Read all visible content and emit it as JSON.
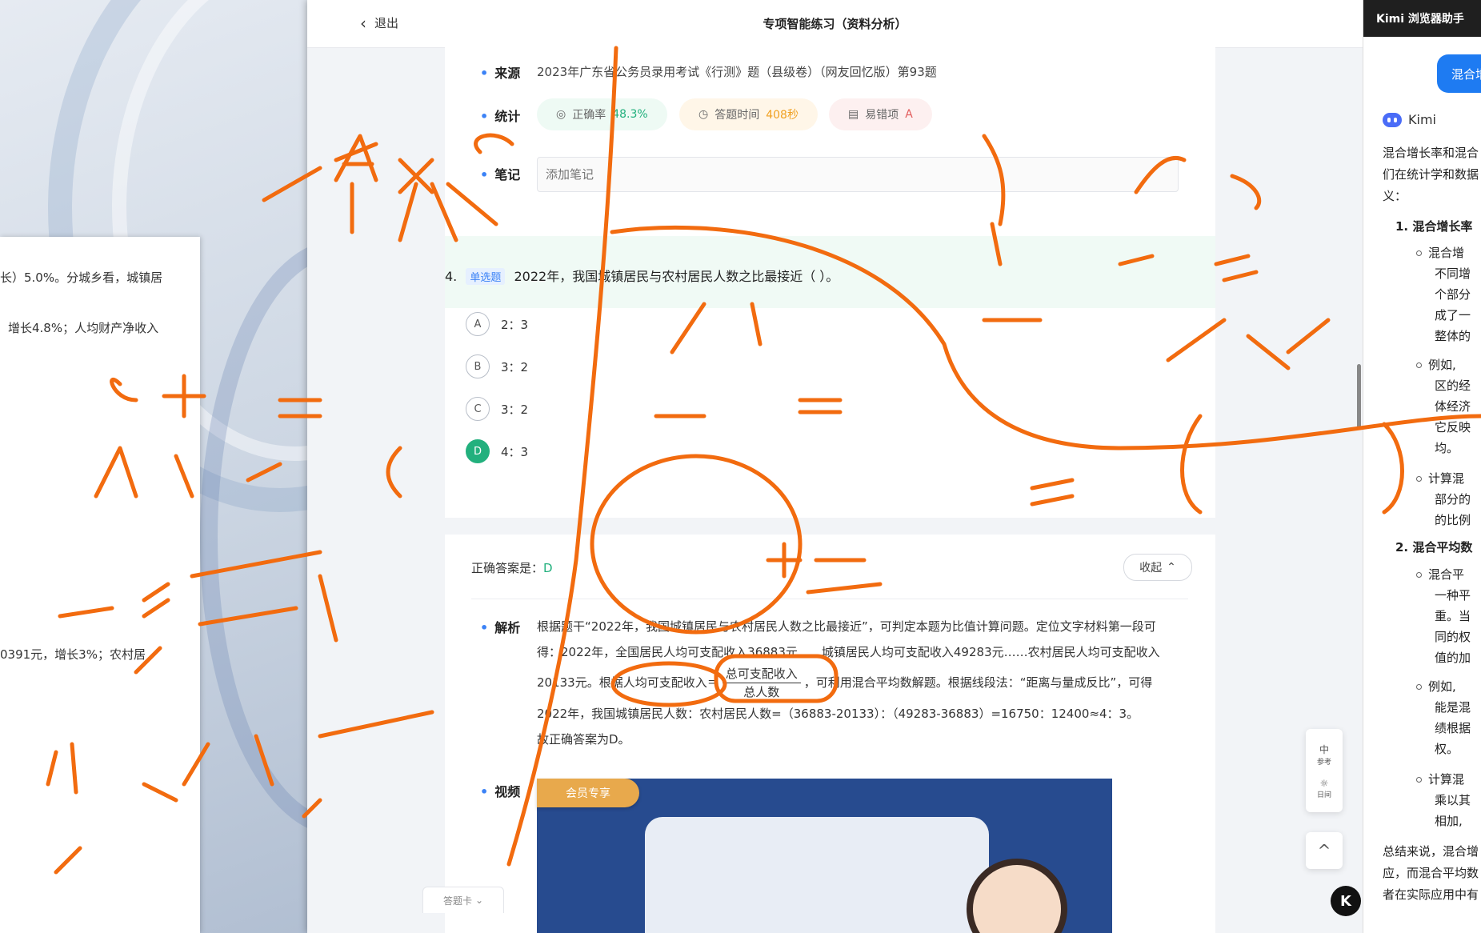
{
  "left_doc": {
    "lines": [
      "长）5.0%。分城乡看，城镇居",
      "增长4.8%；人均财产净收入",
      "0391元，增长3%；农村居"
    ]
  },
  "header": {
    "back_label": "退出",
    "title": "专项智能练习（资料分析）"
  },
  "meta": {
    "source_label": "来源",
    "source_text": "2023年广东省公务员录用考试《行测》题（县级卷）（网友回忆版）第93题",
    "stats_label": "统计",
    "accuracy_label": "正确率",
    "accuracy_value": "48.3%",
    "time_label": "答题时间",
    "time_value": "408秒",
    "wrong_label": "易错项",
    "wrong_value": "A",
    "notes_label": "笔记",
    "notes_placeholder": "添加笔记"
  },
  "question": {
    "number": "4.",
    "tag": "单选题",
    "text": "2022年，我国城镇居民与农村居民人数之比最接近（ ）。",
    "options": [
      {
        "letter": "A",
        "text": "2：3",
        "selected": false
      },
      {
        "letter": "B",
        "text": "3：2",
        "selected": false
      },
      {
        "letter": "C",
        "text": "3：2",
        "selected": false
      },
      {
        "letter": "D",
        "text": "4：3",
        "selected": true
      }
    ]
  },
  "answer": {
    "correct_label": "正确答案是：",
    "correct_value": "D",
    "collapse_label": "收起",
    "analysis_label": "解析",
    "analysis_p1": "根据题干“2022年，我国城镇居民与农村居民人数之比最接近”，可判定本题为比值计算问题。定位文字材料第一段可得：2022年，全国居民人均可支配收入36883元……城镇居民人均可支配收入49283元……农村居民人均可支配收入20133元。根据人均可支配收入＝",
    "frac_num": "总可支配收入",
    "frac_den": "总人数",
    "analysis_p2": "，可利用混合平均数解题。根据线段法：“距离与量成反比”，可得2022年，我国城镇居民人数：农村居民人数=（36883-20133）：（49283-36883）=16750：12400≈4：3。",
    "analysis_p3": "故正确答案为D。",
    "video_label": "视频",
    "vip_label": "会员专享"
  },
  "side_tools": {
    "ref_top": "中",
    "ref_bottom": "参考",
    "day_bottom": "日间",
    "up_icon": "^"
  },
  "answer_sheet_label": "答题卡",
  "kimi": {
    "header": "Kimi 浏览器助手",
    "user_msg": "混合增",
    "bot_name": "Kimi",
    "lines": [
      "混合增长率和混合",
      "们在统计学和数据",
      "义："
    ],
    "h1": "1. 混合增长率",
    "l1": [
      "混合增",
      "不同增",
      "个部分",
      "成了一",
      "整体的"
    ],
    "l2": [
      "例如,",
      "区的经",
      "体经济",
      "它反映",
      "均。"
    ],
    "l3": [
      "计算混",
      "部分的",
      "的比例"
    ],
    "h2": "2. 混合平均数",
    "l4": [
      "混合平",
      "一种平",
      "重。当",
      "同的权",
      "值的加"
    ],
    "l5": [
      "例如,",
      "能是混",
      "绩根据",
      "权。"
    ],
    "l6": [
      "计算混",
      "乘以其",
      "相加,"
    ],
    "summary": [
      "总结来说，混合增",
      "应，而混合平均数",
      "者在实际应用中有"
    ]
  }
}
